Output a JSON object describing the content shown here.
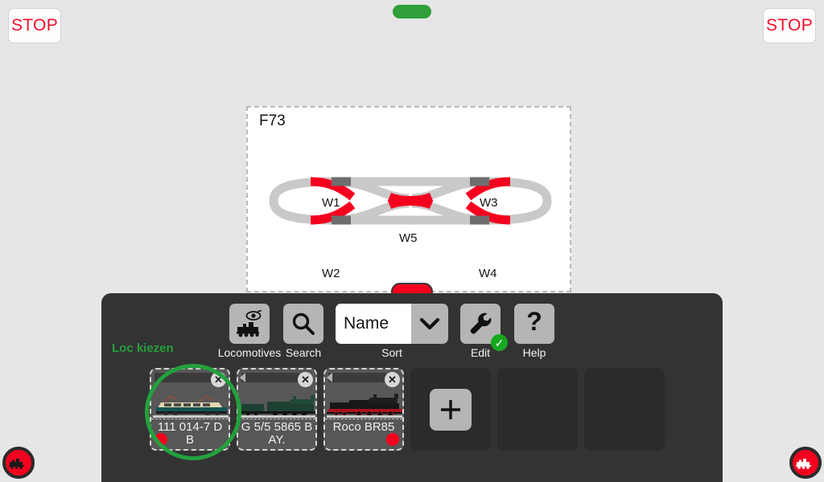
{
  "emergency": {
    "left_label": "STOP",
    "right_label": "STOP",
    "accent": "#f50c2a"
  },
  "indicators": {
    "top_pill_color": "#2fa03a",
    "bottom_pill_color": "#f5001e"
  },
  "track_plan": {
    "title": "F73",
    "switch_labels": [
      "W1",
      "W2",
      "W3",
      "W4",
      "W5"
    ],
    "track_color": "#c9c9c9",
    "active_color": "#f5001e",
    "blocked_color": "#6e6e6e"
  },
  "panel": {
    "title": "Loc kiezen",
    "title_color": "#24a03a",
    "toolbar": [
      {
        "label": "Locomotives",
        "icon": "locomotive-eye-icon",
        "badge": ""
      },
      {
        "label": "Search",
        "icon": "search-icon",
        "badge": ""
      },
      {
        "label": "Edit",
        "icon": "wrench-icon",
        "badge": "check"
      },
      {
        "label": "Help",
        "icon": "question-mark-icon",
        "badge": ""
      }
    ],
    "sort": {
      "label": "Sort",
      "value": "Name",
      "icon": "chevron-down-icon"
    },
    "locomotives": [
      {
        "name": "111 014-7 D B",
        "selected": true,
        "dot": "left",
        "dot_color": "#f5001e",
        "close": "✕",
        "scroll_arrow": false
      },
      {
        "name": "G 5/5 5865 B AY.",
        "selected": false,
        "dot": "none",
        "dot_color": "#f5001e",
        "close": "✕",
        "scroll_arrow": true
      },
      {
        "name": "Roco BR85",
        "selected": false,
        "dot": "right",
        "dot_color": "#f5001e",
        "close": "✕",
        "scroll_arrow": true
      }
    ],
    "add_button": {
      "label": "+",
      "icon": "plus-icon"
    },
    "empty_slots": 2
  },
  "corner_buttons": {
    "left": {
      "icon": "locomotive-icon",
      "glyph_color": "#1a1a1a"
    },
    "right": {
      "icon": "locomotive-icon",
      "glyph_color": "#ffffff"
    }
  }
}
